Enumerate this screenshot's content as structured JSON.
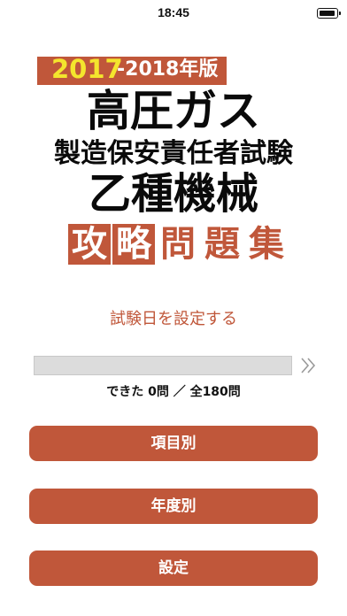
{
  "status_bar": {
    "time": "18:45"
  },
  "logo": {
    "year_main": "2017",
    "year_sub": "-2018年版",
    "line1": "高圧ガス",
    "line2": "製造保安責任者試験",
    "line3": "乙種機械",
    "line4": [
      "攻",
      "略",
      "問",
      "題",
      "集"
    ]
  },
  "exam_date_label": "試験日を設定する",
  "progress": {
    "done": 0,
    "total": 180,
    "label": "できた 0問 ／ 全180問",
    "fraction": 0
  },
  "menu": [
    {
      "label": "項目別"
    },
    {
      "label": "年度別"
    },
    {
      "label": "設定"
    }
  ],
  "colors": {
    "accent": "#c0573a",
    "year_yellow": "#f4e52d",
    "track": "#dcdcdc"
  }
}
